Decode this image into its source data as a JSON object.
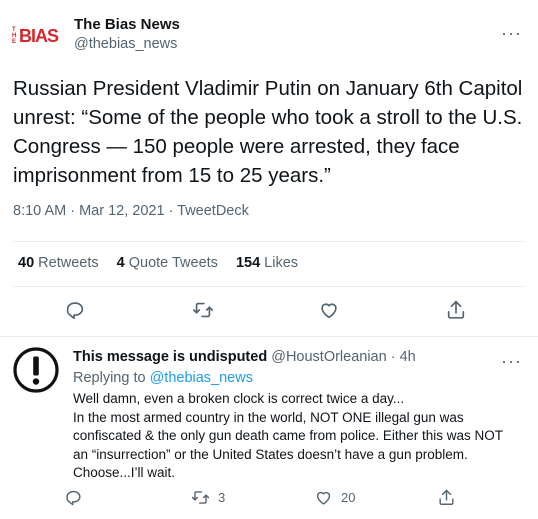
{
  "tweet": {
    "author_name": "The Bias News",
    "author_handle": "@thebias_news",
    "logo_text_small": "THE",
    "logo_text_big": "BIAS",
    "text": "Russian President Vladimir Putin on January 6th Capitol unrest: “Some of the people who took a stroll to the U.S. Congress — 150 people were arrested, they face imprisonment from 15 to 25 years.”",
    "meta": "8:10 AM · Mar 12, 2021 · TweetDeck",
    "stats": {
      "retweets_count": "40",
      "retweets_label": "Retweets",
      "quotes_count": "4",
      "quotes_label": "Quote Tweets",
      "likes_count": "154",
      "likes_label": "Likes"
    },
    "more_icon": "more-horizontal-icon"
  },
  "reply": {
    "author_name": "This message is undisputed",
    "author_handle": "@HoustOrleanian",
    "time": "4h",
    "separator": "·",
    "replying_prefix": "Replying to",
    "replying_to": "@thebias_news",
    "text_lines": [
      "Well damn, even a broken clock is correct twice a day...",
      "In the most armed country in the world, NOT ONE illegal gun was confiscated & the only gun death came from police. Either this was NOT an “insurrection” or the United States doesn’t have a gun problem. Choose...I’ll wait."
    ],
    "retweet_count": "3",
    "like_count": "20"
  },
  "colors": {
    "accent": "#1d9bf0",
    "muted": "#536471",
    "logo_red": "#d6262e"
  }
}
